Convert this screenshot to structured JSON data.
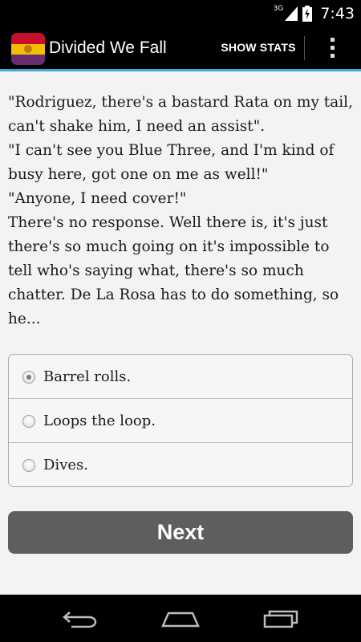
{
  "status_bar": {
    "network": "3G",
    "time": "7:43"
  },
  "action_bar": {
    "title": "Divided We Fall",
    "show_stats_label": "SHOW STATS",
    "accent_color": "#3fa9d8",
    "icon_colors": [
      "#c8102e",
      "#f1bf00",
      "#6a2c70"
    ]
  },
  "story": {
    "paragraphs": [
      "\"Rodriguez, there's a bastard Rata on my tail, can't shake him, I need an assist\".",
      "\"I can't see you Blue Three, and I'm kind of busy here, got one on me as well!\"",
      "\"Anyone, I need cover!\"",
      "There's no response. Well there is, it's just there's so much going on it's impossible to tell who's saying what, there's so much chatter. De La Rosa has to do something, so he..."
    ]
  },
  "choices": {
    "selected_index": 0,
    "options": [
      "Barrel rolls.",
      "Loops the loop.",
      "Dives."
    ]
  },
  "next_button": {
    "label": "Next",
    "color": "#5e5e5e"
  },
  "nav_bar": {
    "icons": [
      "back-icon",
      "home-icon",
      "recent-apps-icon"
    ]
  }
}
